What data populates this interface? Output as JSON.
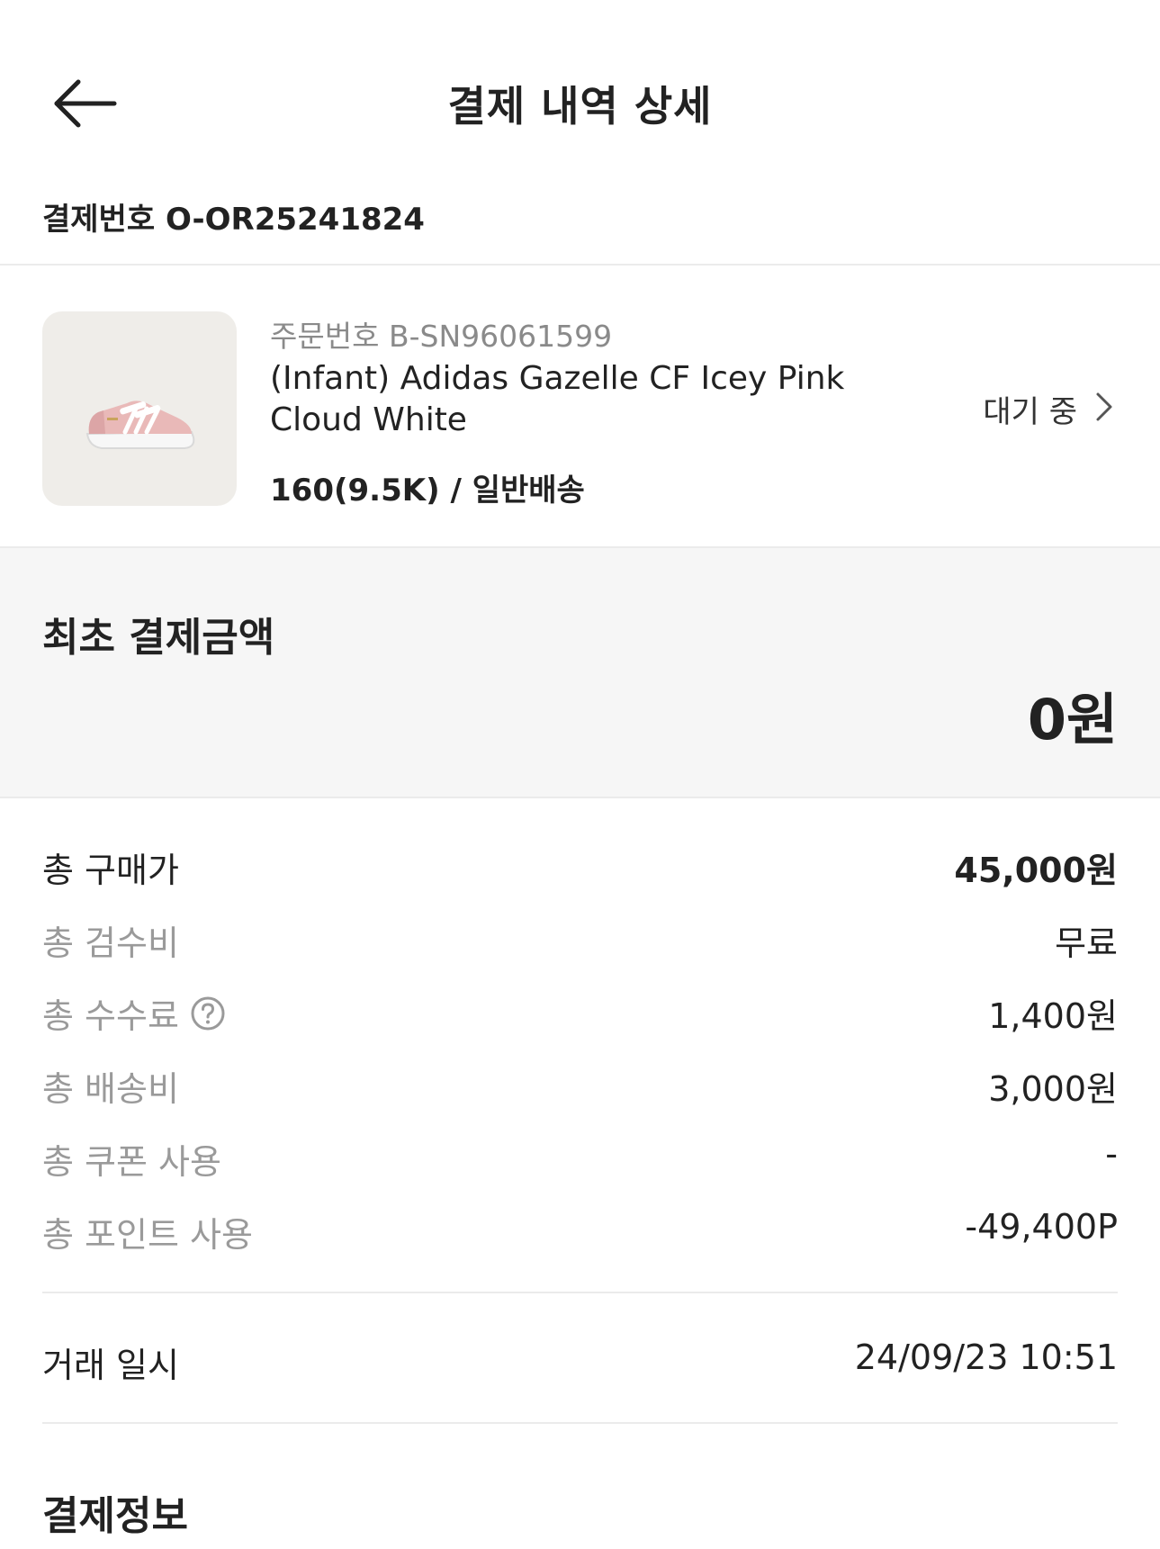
{
  "header": {
    "title": "결제 내역 상세"
  },
  "payment": {
    "label": "결제번호",
    "number": "O-OR25241824"
  },
  "product": {
    "order_label": "주문번호",
    "order_number": "B-SN96061599",
    "name": "(Infant) Adidas Gazelle CF Icey Pink Cloud White",
    "option": "160(9.5K) / 일반배송",
    "status": "대기 중"
  },
  "initial_payment": {
    "label": "최초 결제금액",
    "amount": "0원"
  },
  "breakdown": [
    {
      "label": "총 구매가",
      "value": "45,000원"
    },
    {
      "label": "총 검수비",
      "value": "무료"
    },
    {
      "label": "총 수수료",
      "value": "1,400원"
    },
    {
      "label": "총 배송비",
      "value": "3,000원"
    },
    {
      "label": "총 쿠폰 사용",
      "value": "-"
    },
    {
      "label": "총 포인트 사용",
      "value": "-49,400P"
    }
  ],
  "transaction": {
    "label": "거래 일시",
    "value": "24/09/23 10:51"
  },
  "section": {
    "payment_info": "결제정보"
  }
}
